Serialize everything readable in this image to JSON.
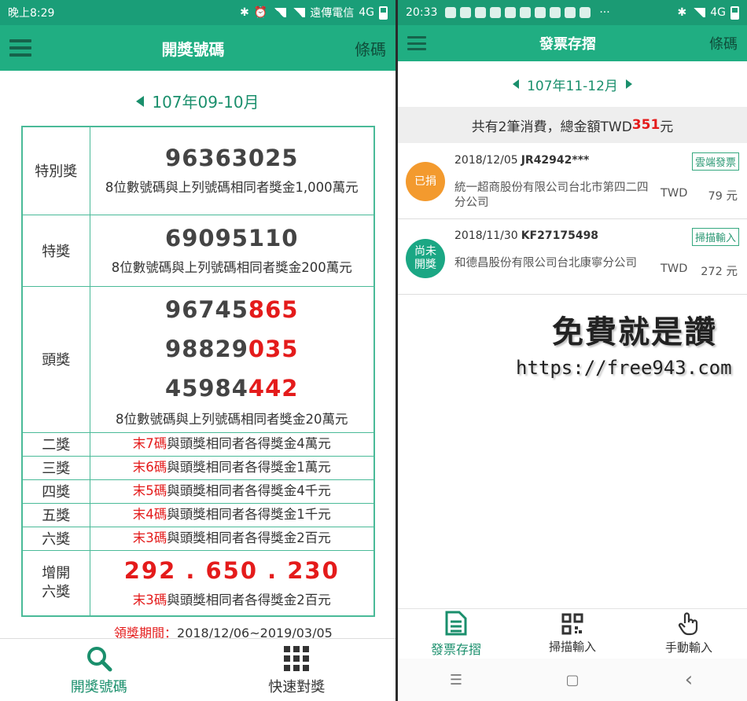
{
  "left": {
    "status": {
      "time": "晚上8:29",
      "carrier": "遠傳電信",
      "network": "4G"
    },
    "appbar": {
      "title": "開獎號碼",
      "action": "條碼"
    },
    "period": "107年09-10月",
    "prizes": {
      "special": {
        "name": "特別獎",
        "number": "96363025",
        "note": "8位數號碼與上列號碼相同者獎金1,000萬元"
      },
      "grand": {
        "name": "特獎",
        "number": "69095110",
        "note": "8位數號碼與上列號碼相同者獎金200萬元"
      },
      "first": {
        "name": "頭獎",
        "numbers": [
          {
            "prefix": "96745",
            "suffix": "865"
          },
          {
            "prefix": "98829",
            "suffix": "035"
          },
          {
            "prefix": "45984",
            "suffix": "442"
          }
        ],
        "note": "8位數號碼與上列號碼相同者獎金20萬元"
      },
      "second": {
        "name": "二獎",
        "red": "末7碼",
        "rest": "與頭獎相同者各得獎金4萬元"
      },
      "third": {
        "name": "三獎",
        "red": "末6碼",
        "rest": "與頭獎相同者各得獎金1萬元"
      },
      "fourth": {
        "name": "四獎",
        "red": "末5碼",
        "rest": "與頭獎相同者各得獎金4千元"
      },
      "fifth": {
        "name": "五獎",
        "red": "末4碼",
        "rest": "與頭獎相同者各得獎金1千元"
      },
      "sixth": {
        "name": "六獎",
        "red": "末3碼",
        "rest": "與頭獎相同者各得獎金2百元"
      },
      "extra": {
        "name_line1": "增開",
        "name_line2": "六獎",
        "numbers": "292 . 650 . 230",
        "red": "末3碼",
        "rest": "與頭獎相同者各得獎金2百元"
      }
    },
    "claim": {
      "label": "領獎期間：",
      "dates": "2018/12/06~2019/03/05"
    },
    "nav": {
      "tab1": "開獎號碼",
      "tab2": "快速對獎"
    }
  },
  "right": {
    "status": {
      "time": "20:33",
      "network": "4G",
      "dots": "···"
    },
    "appbar": {
      "title": "發票存摺",
      "action": "條碼"
    },
    "period": "107年11-12月",
    "summary": {
      "prefix": "共有2筆消費，總金額TWD",
      "amount": "351",
      "suffix": "元"
    },
    "invoices": [
      {
        "badge": "已捐",
        "date": "2018/12/05",
        "code": "JR42942***",
        "store": "統一超商股份有限公司台北市第四二四分公司",
        "currency": "TWD",
        "amount": "79 元",
        "tag": "雲端發票",
        "color": "#f39a2e"
      },
      {
        "badge_line1": "尚未",
        "badge_line2": "開獎",
        "date": "2018/11/30",
        "code": "KF27175498",
        "store": "和德昌股份有限公司台北康寧分公司",
        "currency": "TWD",
        "amount": "272 元",
        "tag": "掃描輸入",
        "color": "#1ba784"
      }
    ],
    "watermark": {
      "title": "免費就是讚",
      "url": "https://free943.com"
    },
    "nav": {
      "tab1": "發票存摺",
      "tab2": "掃描輸入",
      "tab3": "手動輸入"
    },
    "sysnav": {
      "menu": "☰",
      "home": "▢",
      "back": "‹"
    }
  },
  "colors": {
    "accent": "#20ae82",
    "status": "#1a9e78",
    "red": "#e41b1b",
    "donated": "#f39a2e",
    "pending": "#1ba784"
  }
}
